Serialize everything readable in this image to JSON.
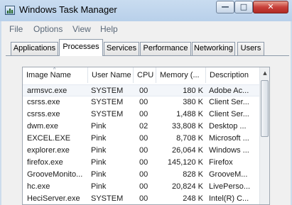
{
  "window": {
    "title": "Windows Task Manager"
  },
  "titlebar_buttons": {
    "minimize": "—",
    "maximize": "□",
    "close": "✕"
  },
  "menu": [
    "File",
    "Options",
    "View",
    "Help"
  ],
  "tabs": [
    {
      "label": "Applications",
      "active": false
    },
    {
      "label": "Processes",
      "active": true
    },
    {
      "label": "Services",
      "active": false
    },
    {
      "label": "Performance",
      "active": false
    },
    {
      "label": "Networking",
      "active": false
    },
    {
      "label": "Users",
      "active": false
    }
  ],
  "table": {
    "columns": [
      "Image Name",
      "User Name",
      "CPU",
      "Memory (...",
      "Description"
    ],
    "sort_indicator": "^",
    "rows": [
      {
        "image": "armsvc.exe",
        "user": "SYSTEM",
        "cpu": "00",
        "memory": "180 K",
        "description": "Adobe Ac...",
        "selected": true
      },
      {
        "image": "csrss.exe",
        "user": "SYSTEM",
        "cpu": "00",
        "memory": "380 K",
        "description": "Client Ser..."
      },
      {
        "image": "csrss.exe",
        "user": "SYSTEM",
        "cpu": "00",
        "memory": "1,488 K",
        "description": "Client Ser..."
      },
      {
        "image": "dwm.exe",
        "user": "Pink",
        "cpu": "02",
        "memory": "33,808 K",
        "description": "Desktop ..."
      },
      {
        "image": "EXCEL.EXE",
        "user": "Pink",
        "cpu": "00",
        "memory": "8,708 K",
        "description": "Microsoft ..."
      },
      {
        "image": "explorer.exe",
        "user": "Pink",
        "cpu": "00",
        "memory": "26,064 K",
        "description": "Windows ..."
      },
      {
        "image": "firefox.exe",
        "user": "Pink",
        "cpu": "00",
        "memory": "145,120 K",
        "description": "Firefox"
      },
      {
        "image": "GrooveMonito...",
        "user": "Pink",
        "cpu": "00",
        "memory": "828 K",
        "description": "GrooveM..."
      },
      {
        "image": "hc.exe",
        "user": "Pink",
        "cpu": "00",
        "memory": "20,824 K",
        "description": "LivePerso..."
      },
      {
        "image": "HeciServer.exe",
        "user": "SYSTEM",
        "cpu": "00",
        "memory": "248 K",
        "description": "Intel(R) C..."
      }
    ]
  },
  "scrollbar": {
    "up_arrow": "▲"
  }
}
